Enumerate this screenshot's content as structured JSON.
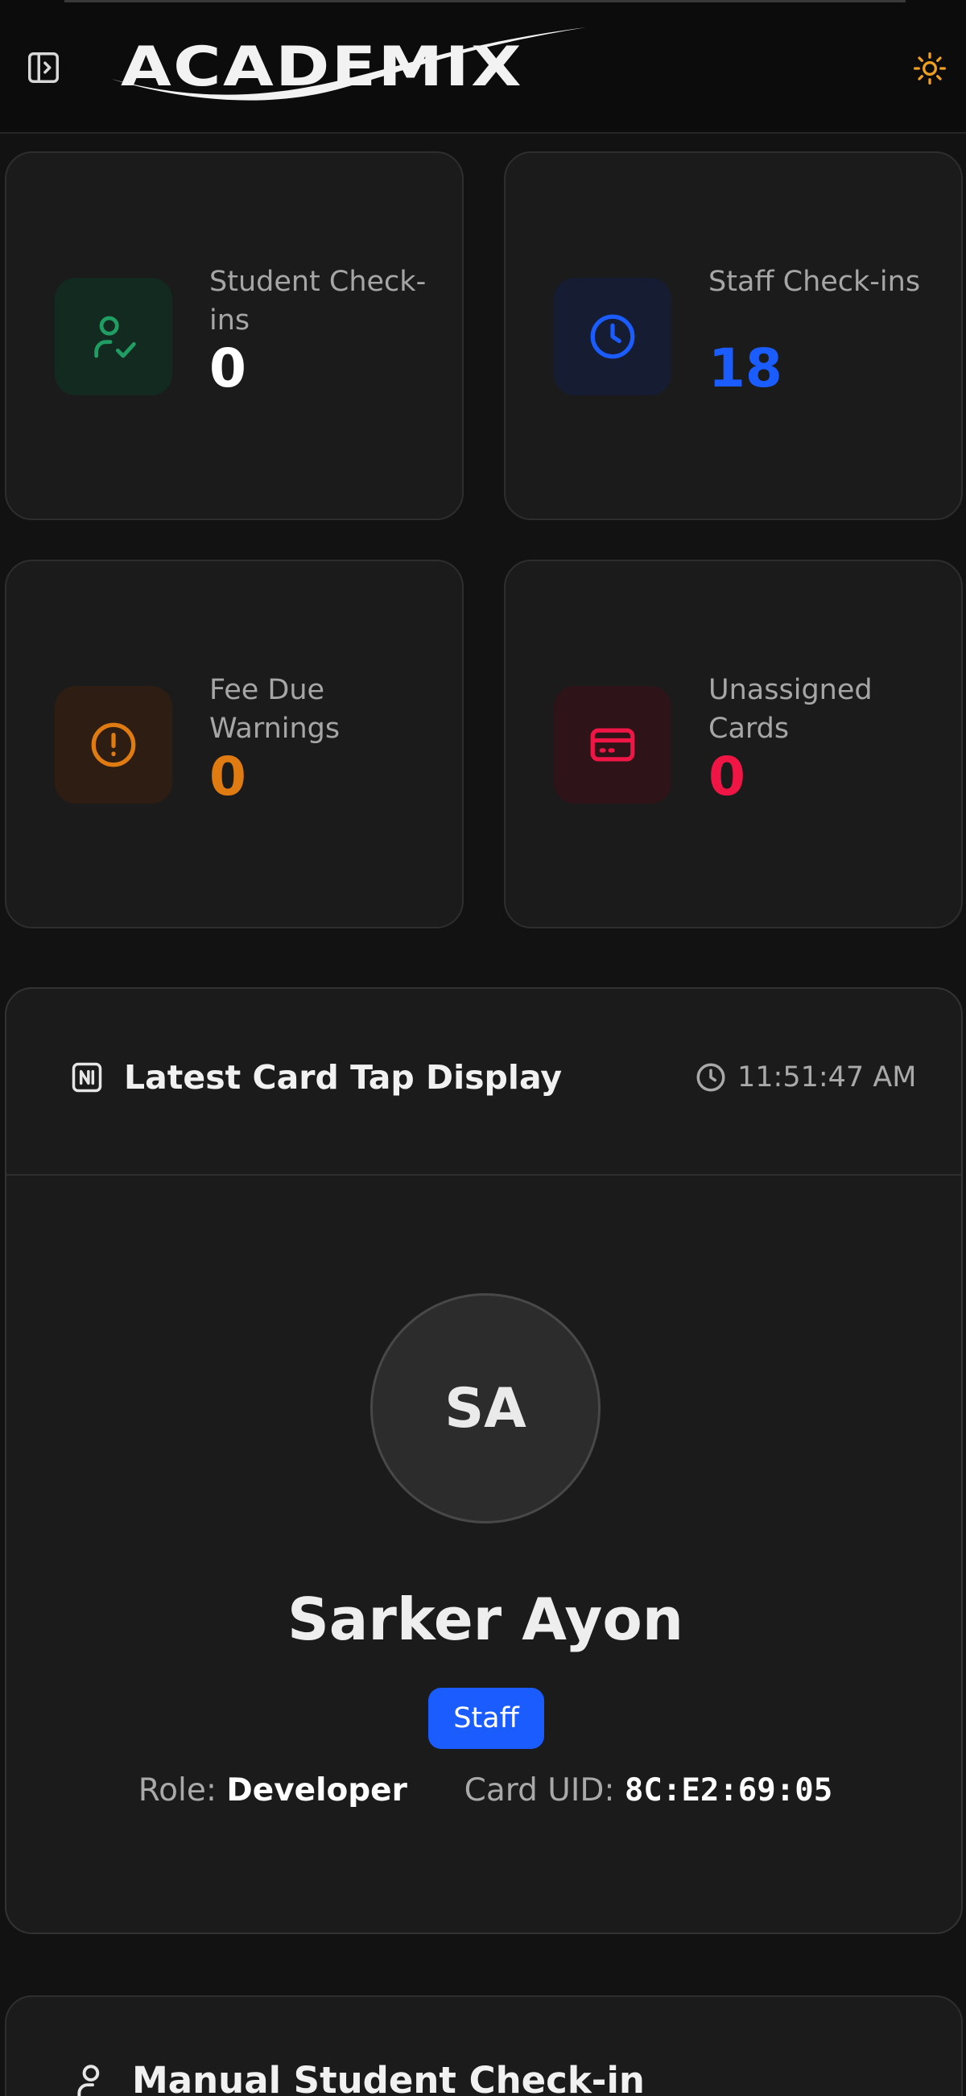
{
  "header": {
    "logo_text": "ACADEMIX",
    "icons": [
      "sidebar-toggle-icon",
      "sun-icon"
    ]
  },
  "stats": [
    {
      "label": "Student Check-ins",
      "value": "0",
      "icon": "user-check-icon",
      "color": "#ffffff",
      "icon_color": "#1f9d63",
      "icon_bg": "#122a20"
    },
    {
      "label": "Staff Check-ins",
      "value": "18",
      "icon": "clock-icon",
      "color": "#1a5cff",
      "icon_color": "#1a5cff",
      "icon_bg": "#161d33"
    },
    {
      "label": "Fee Due Warnings",
      "value": "0",
      "icon": "alert-circle-icon",
      "color": "#e07b12",
      "icon_color": "#e07b12",
      "icon_bg": "#2e1d12"
    },
    {
      "label": "Unassigned Cards",
      "value": "0",
      "icon": "credit-card-icon",
      "color": "#ef1646",
      "icon_color": "#ef1646",
      "icon_bg": "#2e1318"
    }
  ],
  "tap": {
    "title": "Latest Card Tap Display",
    "time": "11:51:47 AM",
    "initials": "SA",
    "name": "Sarker Ayon",
    "badge": "Staff",
    "role_label": "Role:",
    "role": "Developer",
    "uid_label": "Card UID:",
    "uid": "8C:E2:69:05"
  },
  "manual": {
    "title": "Manual Student Check-in"
  },
  "colors": {
    "background": "#121212",
    "card": "#1b1b1b",
    "accent": "#1a5cff",
    "sun": "#f0a020"
  }
}
